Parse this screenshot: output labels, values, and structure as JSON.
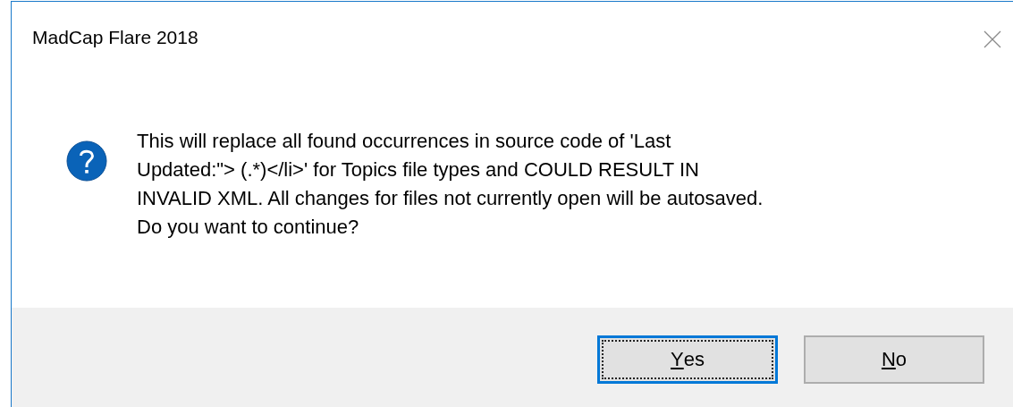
{
  "window": {
    "title": "MadCap Flare 2018"
  },
  "message": {
    "lines": [
      "This will replace all found occurrences in source code of 'Last",
      "Updated:\"> (.*)</li>' for Topics file types and COULD RESULT IN",
      "INVALID XML. All changes for files not currently open will be autosaved.",
      "Do you want to continue?"
    ]
  },
  "buttons": [
    {
      "access_key": "Y",
      "label_rest": "es",
      "focused": true
    },
    {
      "access_key": "N",
      "label_rest": "o",
      "focused": false
    }
  ]
}
